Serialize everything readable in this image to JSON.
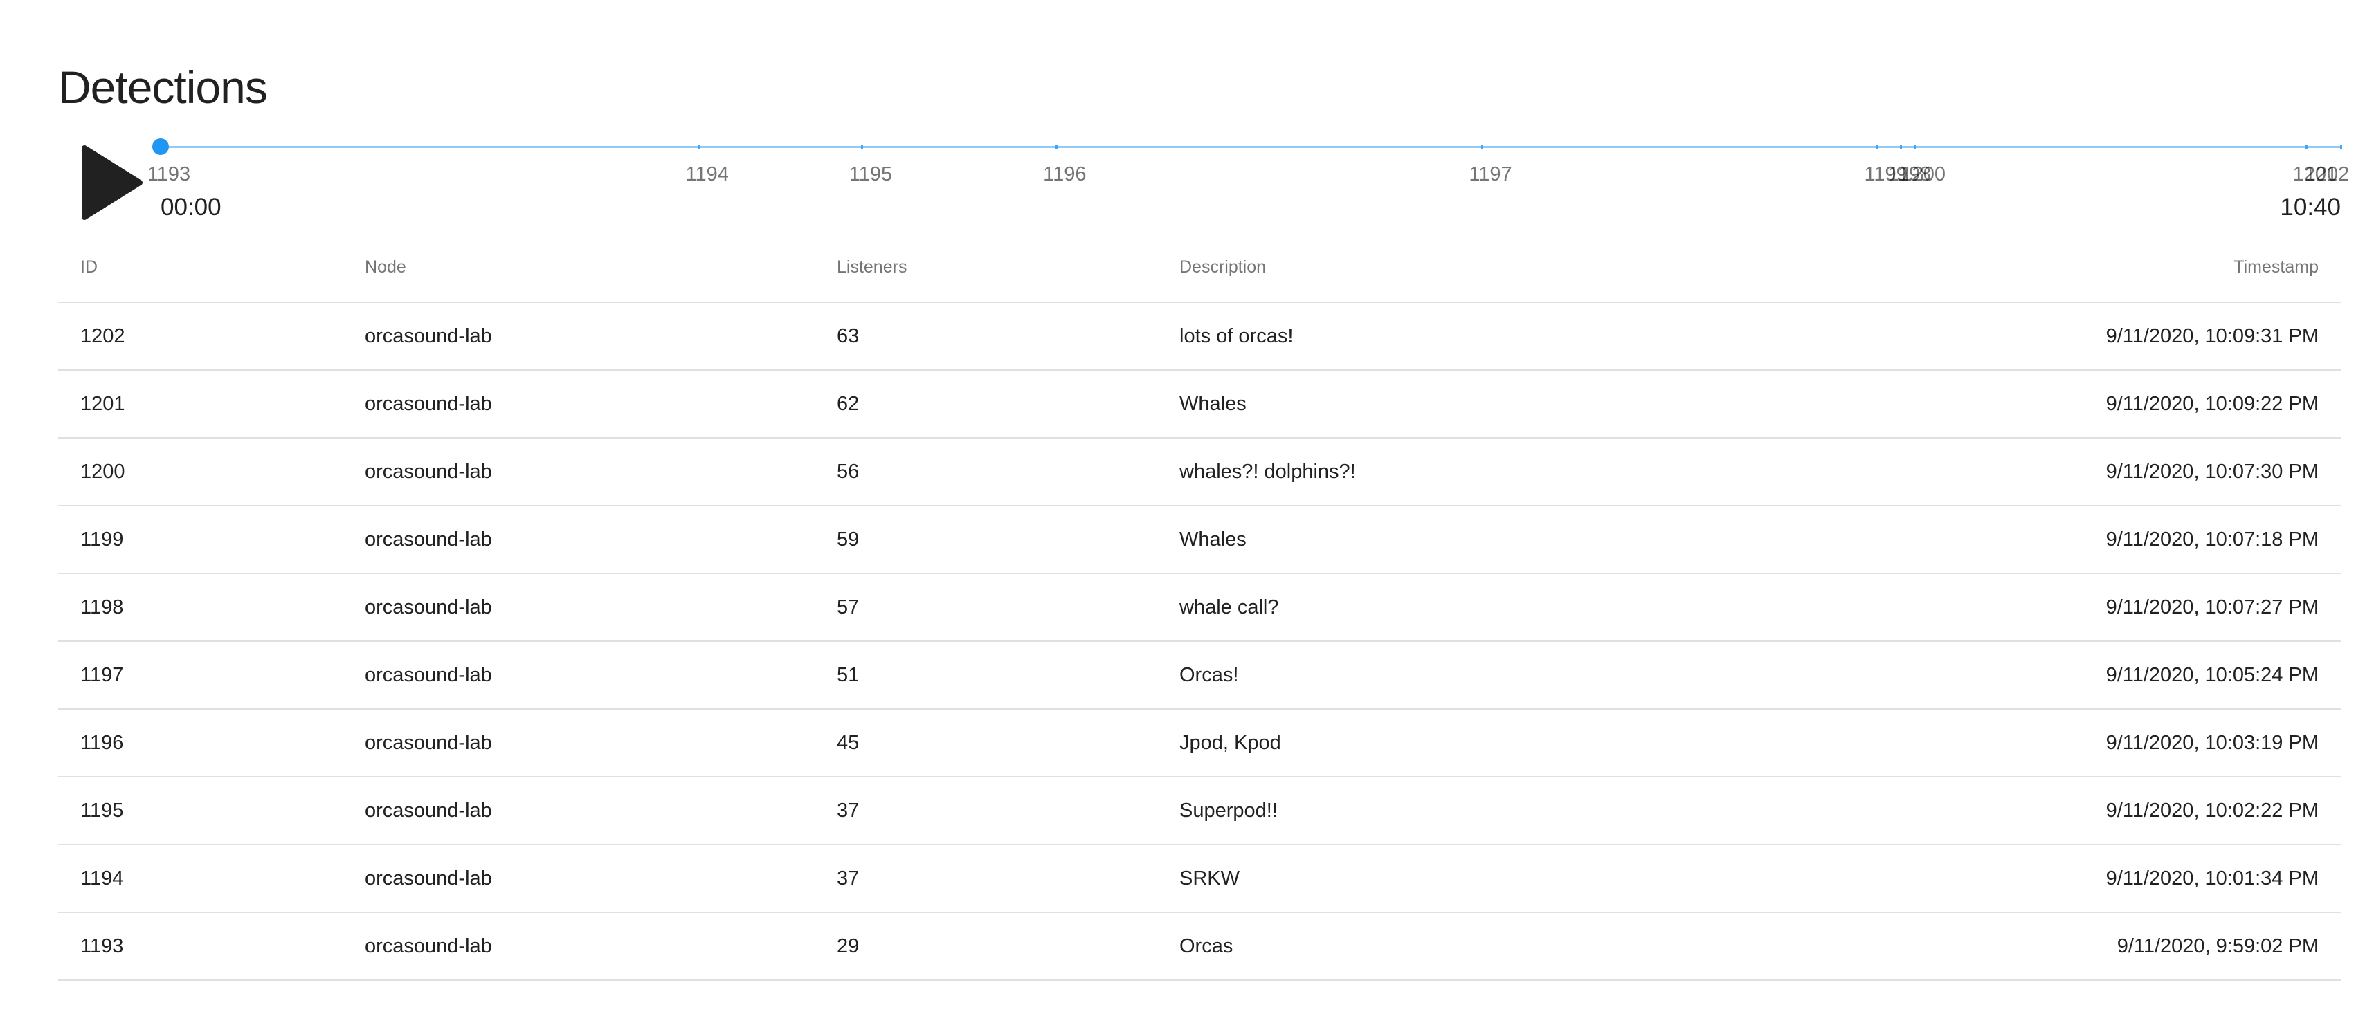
{
  "page": {
    "title": "Detections"
  },
  "player": {
    "play_icon": "play-icon",
    "current_time": "00:00",
    "end_time": "10:40",
    "progress": 0,
    "track_color": "#90caf9",
    "thumb_color": "#2196f3",
    "marks": [
      {
        "label": "1193",
        "position": 0.0
      },
      {
        "label": "1194",
        "position": 0.2469
      },
      {
        "label": "1195",
        "position": 0.3219
      },
      {
        "label": "1196",
        "position": 0.4109
      },
      {
        "label": "1197",
        "position": 0.6062
      },
      {
        "label": "1199",
        "position": 0.7875
      },
      {
        "label": "1198",
        "position": 0.7984
      },
      {
        "label": "1200",
        "position": 0.8047
      },
      {
        "label": "1201",
        "position": 0.9844
      },
      {
        "label": "1202",
        "position": 1.0
      }
    ]
  },
  "table": {
    "columns": {
      "id": "ID",
      "node": "Node",
      "listeners": "Listeners",
      "description": "Description",
      "timestamp": "Timestamp"
    },
    "rows": [
      {
        "id": "1202",
        "node": "orcasound-lab",
        "listeners": "63",
        "description": "lots of orcas!",
        "timestamp": "9/11/2020, 10:09:31 PM"
      },
      {
        "id": "1201",
        "node": "orcasound-lab",
        "listeners": "62",
        "description": "Whales",
        "timestamp": "9/11/2020, 10:09:22 PM"
      },
      {
        "id": "1200",
        "node": "orcasound-lab",
        "listeners": "56",
        "description": "whales?! dolphins?!",
        "timestamp": "9/11/2020, 10:07:30 PM"
      },
      {
        "id": "1199",
        "node": "orcasound-lab",
        "listeners": "59",
        "description": "Whales",
        "timestamp": "9/11/2020, 10:07:18 PM"
      },
      {
        "id": "1198",
        "node": "orcasound-lab",
        "listeners": "57",
        "description": "whale call?",
        "timestamp": "9/11/2020, 10:07:27 PM"
      },
      {
        "id": "1197",
        "node": "orcasound-lab",
        "listeners": "51",
        "description": "Orcas!",
        "timestamp": "9/11/2020, 10:05:24 PM"
      },
      {
        "id": "1196",
        "node": "orcasound-lab",
        "listeners": "45",
        "description": "Jpod, Kpod",
        "timestamp": "9/11/2020, 10:03:19 PM"
      },
      {
        "id": "1195",
        "node": "orcasound-lab",
        "listeners": "37",
        "description": "Superpod!!",
        "timestamp": "9/11/2020, 10:02:22 PM"
      },
      {
        "id": "1194",
        "node": "orcasound-lab",
        "listeners": "37",
        "description": "SRKW",
        "timestamp": "9/11/2020, 10:01:34 PM"
      },
      {
        "id": "1193",
        "node": "orcasound-lab",
        "listeners": "29",
        "description": "Orcas",
        "timestamp": "9/11/2020, 9:59:02 PM"
      }
    ]
  }
}
